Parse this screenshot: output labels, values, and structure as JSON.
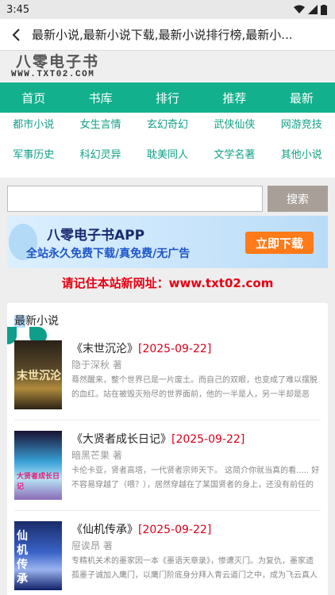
{
  "status": {
    "time": "3:45"
  },
  "topbar": {
    "title": "最新小说,最新小说下载,最新小说排行榜,最新小..."
  },
  "logo": {
    "cn": "八零电子书",
    "en": "WWW.TXT02.COM"
  },
  "nav": [
    "首页",
    "书库",
    "排行",
    "推荐",
    "最新"
  ],
  "categories": [
    "都市小说",
    "女生言情",
    "玄幻奇幻",
    "武侠仙侠",
    "网游竞技",
    "军事历史",
    "科幻灵异",
    "耽美同人",
    "文学名著",
    "其他小说"
  ],
  "search": {
    "placeholder": "",
    "button": "搜索"
  },
  "banner": {
    "line1": "八零电子书APP",
    "line2": "全站永久免费下载/真免费/无广告",
    "button": "立即下载"
  },
  "notice": "请记住本站新网址：www.txt02.com",
  "latest": {
    "title_hl": "最",
    "title_rest": "新小说",
    "books": [
      {
        "cover_text": "末世沉沦",
        "name": "《末世沉沦》",
        "date": "[2025-09-22]",
        "author": "隐于深秋 著",
        "desc": "蓦然醒来，整个世界已是一片废土。而自己的双眼，也变成了难以摆脱的血红。站在被毁灭殆尽的世界面前，他的一半是人，另一半却是恶魔。永生挣"
      },
      {
        "cover_text": "大贤者成长日记",
        "name": "《大贤者成长日记》",
        "date": "[2025-09-22]",
        "author": "暗黑芒果 著",
        "desc": "卡伦卡亚，贤者高塔，一代贤者宗师天下。 这简介你就当真的看..... 好不容易穿越了（喂？），居然穿越在了某国贤者的身上，还没有前任的任何记"
      },
      {
        "cover_text": "仙机传承",
        "name": "《仙机传承》",
        "date": "[2025-09-22]",
        "author": "屉诶昂 著",
        "desc": "专精机关术的墨家因一本《墨语天章录》，惨遭灭门。为复仇，墨家遗孤墨子诚加入鹰门，以鹰门阶底身分拜入青云道门之中，成为飞云真人座下守宇"
      }
    ]
  }
}
